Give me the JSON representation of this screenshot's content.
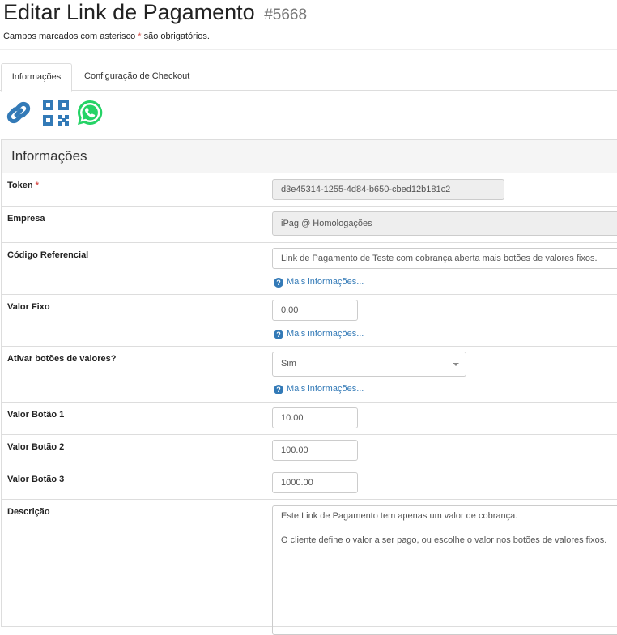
{
  "header": {
    "title": "Editar Link de Pagamento",
    "record_id": "#5668",
    "required_note_before": "Campos marcados com asterisco ",
    "required_star": "*",
    "required_note_after": " são obrigatórios."
  },
  "tabs": [
    {
      "label": "Informações",
      "active": true
    },
    {
      "label": "Configuração de Checkout",
      "active": false
    }
  ],
  "toolbar_icons": [
    "link-icon",
    "qr-code-icon",
    "whatsapp-icon"
  ],
  "colors": {
    "link_blue": "#337ab7",
    "whatsapp_green": "#25d366",
    "required_red": "#d9534f"
  },
  "panel": {
    "title": "Informações"
  },
  "fields": {
    "token": {
      "label": "Token",
      "required": "*",
      "value": "d3e45314-1255-4d84-b650-cbed12b181c2"
    },
    "empresa": {
      "label": "Empresa",
      "value": "iPag @ Homologações"
    },
    "codigo_referencial": {
      "label": "Código Referencial",
      "value": "Link de Pagamento de Teste com cobrança aberta mais botões de valores fixos.",
      "help": "Mais informações..."
    },
    "valor_fixo": {
      "label": "Valor Fixo",
      "value": "0.00",
      "help": "Mais informações..."
    },
    "ativar_botoes": {
      "label": "Ativar botões de valores?",
      "value": "Sim",
      "help": "Mais informações..."
    },
    "valor_botao_1": {
      "label": "Valor Botão 1",
      "value": "10.00"
    },
    "valor_botao_2": {
      "label": "Valor Botão 2",
      "value": "100.00"
    },
    "valor_botao_3": {
      "label": "Valor Botão 3",
      "value": "1000.00"
    },
    "descricao": {
      "label": "Descrição",
      "line1": "Este Link de Pagamento tem apenas um valor de cobrança.",
      "line2": "O cliente define o valor a ser pago, ou escolhe o valor nos botões de valores fixos."
    }
  },
  "help_icon": "?"
}
